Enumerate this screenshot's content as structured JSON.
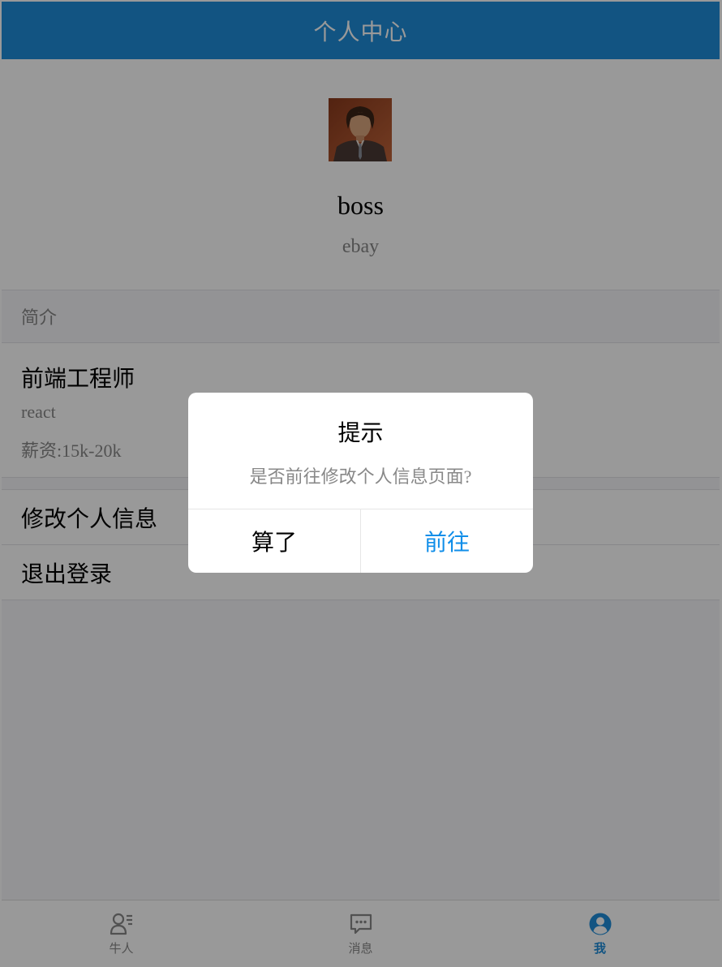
{
  "header": {
    "title": "个人中心"
  },
  "profile": {
    "name": "boss",
    "company": "ebay",
    "avatar_icon": "portrait-avatar"
  },
  "brief": {
    "section_label": "简介",
    "title": "前端工程师",
    "lines": [
      "react",
      "薪资:15k-20k"
    ]
  },
  "actions": [
    {
      "label": "修改个人信息"
    },
    {
      "label": "退出登录"
    }
  ],
  "tabbar": {
    "tabs": [
      {
        "label": "牛人",
        "icon": "user-list-icon",
        "active": false
      },
      {
        "label": "消息",
        "icon": "chat-bubble-icon",
        "active": false
      },
      {
        "label": "我",
        "icon": "user-circle-icon",
        "active": true
      }
    ]
  },
  "modal": {
    "title": "提示",
    "message": "是否前往修改个人信息页面?",
    "cancel_label": "算了",
    "confirm_label": "前往"
  },
  "colors": {
    "primary": "#1f8dd9",
    "link": "#108ee9",
    "overlay": "rgba(0,0,0,0.4)"
  }
}
